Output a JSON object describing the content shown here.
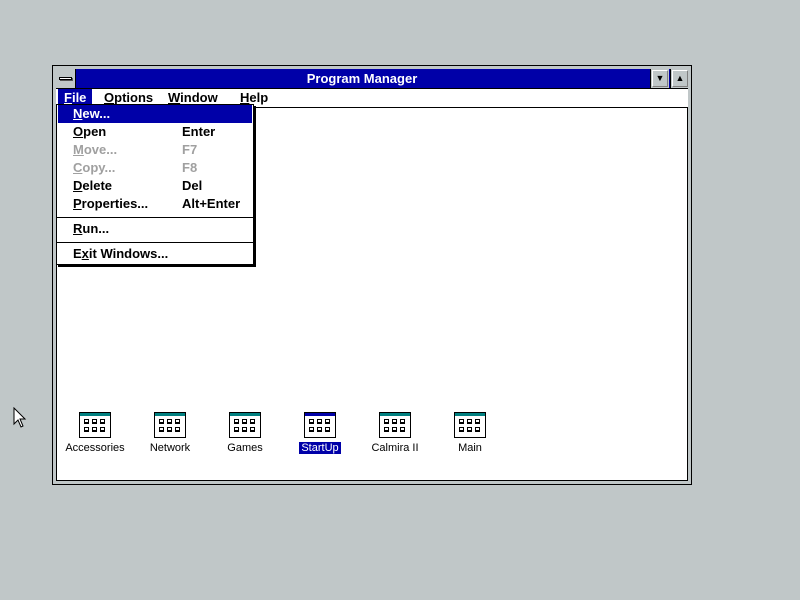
{
  "window": {
    "title": "Program Manager",
    "minimize_icon": "minimize-down-arrow-icon",
    "maximize_icon": "maximize-up-arrow-icon"
  },
  "menubar": [
    {
      "label": "File",
      "mnemonic": "F",
      "rest": "ile",
      "active": true
    },
    {
      "label": "Options",
      "mnemonic": "O",
      "rest": "ptions",
      "active": false
    },
    {
      "label": "Window",
      "mnemonic": "W",
      "rest": "indow",
      "active": false
    },
    {
      "label": "Help",
      "mnemonic": "H",
      "rest": "elp",
      "active": false
    }
  ],
  "file_menu": {
    "items": [
      {
        "pre": "",
        "mnemonic": "N",
        "post": "ew...",
        "shortcut": "",
        "state": "highlighted"
      },
      {
        "pre": "",
        "mnemonic": "O",
        "post": "pen",
        "shortcut": "Enter",
        "state": "enabled"
      },
      {
        "pre": "",
        "mnemonic": "M",
        "post": "ove...",
        "shortcut": "F7",
        "state": "disabled"
      },
      {
        "pre": "",
        "mnemonic": "C",
        "post": "opy...",
        "shortcut": "F8",
        "state": "disabled"
      },
      {
        "pre": "",
        "mnemonic": "D",
        "post": "elete",
        "shortcut": "Del",
        "state": "enabled"
      },
      {
        "pre": "",
        "mnemonic": "P",
        "post": "roperties...",
        "shortcut": "Alt+Enter",
        "state": "enabled"
      },
      {
        "pre": "",
        "mnemonic": "R",
        "post": "un...",
        "shortcut": "",
        "state": "enabled"
      },
      {
        "pre": "E",
        "mnemonic": "x",
        "post": "it Windows...",
        "shortcut": "",
        "state": "enabled"
      }
    ]
  },
  "program_groups": [
    {
      "label": "Accessories",
      "selected": false
    },
    {
      "label": "Network",
      "selected": false
    },
    {
      "label": "Games",
      "selected": false
    },
    {
      "label": "StartUp",
      "selected": true
    },
    {
      "label": "Calmira II",
      "selected": false
    },
    {
      "label": "Main",
      "selected": false
    }
  ],
  "colors": {
    "desktop": "#c0c7c8",
    "titlebar": "#0000a8",
    "highlight": "#0000a8",
    "disabled_text": "#a0a0a0"
  }
}
